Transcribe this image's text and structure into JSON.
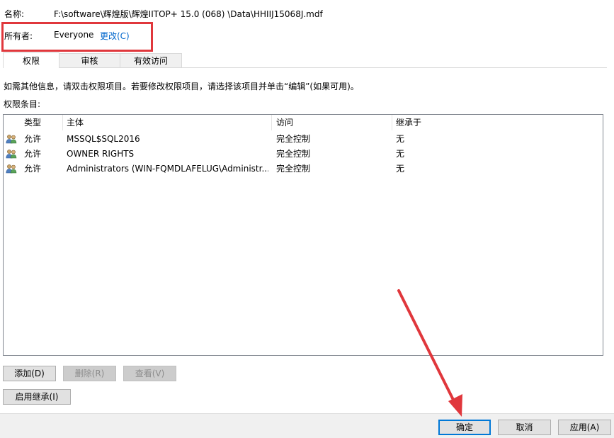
{
  "header": {
    "name_label": "名称:",
    "name_value": "F:\\software\\辉煌版\\辉煌IITOP+ 15.0  (068)  \\Data\\HHIIJ15068J.mdf",
    "owner_label": "所有者:",
    "owner_value": "Everyone",
    "change_link": "更改(C)"
  },
  "tabs": [
    {
      "label": "权限"
    },
    {
      "label": "审核"
    },
    {
      "label": "有效访问"
    }
  ],
  "info_text": "如需其他信息，请双击权限项目。若要修改权限项目，请选择该项目并单击“编辑”(如果可用)。",
  "entries_label": "权限条目:",
  "table": {
    "columns": [
      "类型",
      "主体",
      "访问",
      "继承于"
    ],
    "rows": [
      {
        "type": "允许",
        "principal": "MSSQL$SQL2016",
        "access": "完全控制",
        "inherited": "无"
      },
      {
        "type": "允许",
        "principal": "OWNER RIGHTS",
        "access": "完全控制",
        "inherited": "无"
      },
      {
        "type": "允许",
        "principal": "Administrators (WIN-FQMDLAFELUG\\Administr...",
        "access": "完全控制",
        "inherited": "无"
      }
    ]
  },
  "buttons": {
    "add": "添加(D)",
    "remove": "删除(R)",
    "view": "查看(V)",
    "enable_inheritance": "启用继承(I)"
  },
  "footer": {
    "ok": "确定",
    "cancel": "取消",
    "apply": "应用(A)"
  },
  "colors": {
    "annotation_red": "#e0373c",
    "link_blue": "#0066cc",
    "accent": "#0078d7"
  }
}
